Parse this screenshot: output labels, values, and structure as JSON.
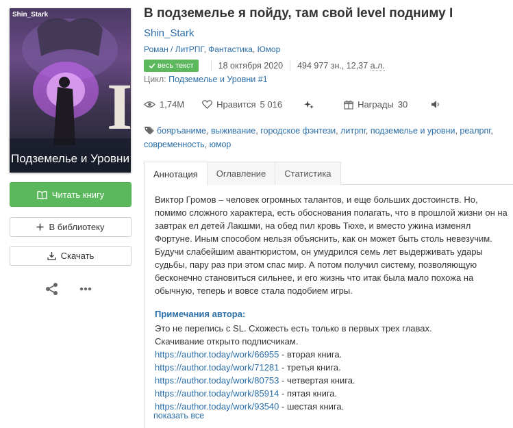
{
  "book": {
    "title": "В подземелье я пойду, там свой level подниму I",
    "author": "Shin_Stark",
    "genre_main": "Роман / ЛитРПГ",
    "genre_2": "Фантастика",
    "genre_3": "Юмор",
    "badge": "весь текст",
    "date": "18 октября 2020",
    "size_chars": "494 977 зн., 12,37",
    "size_unit": "а.л.",
    "cycle_label": "Цикл:",
    "cycle_name": "Подземелье и Уровни",
    "cycle_num": "#1"
  },
  "cover": {
    "author": "Shin_Stark",
    "numeral": "I",
    "title": "Подземелье и Уровни"
  },
  "actions": {
    "read": "Читать книгу",
    "library": "В библиотеку",
    "download": "Скачать"
  },
  "stats": {
    "views": "1,74M",
    "likes_label": "Нравится",
    "likes": "5 016",
    "awards_label": "Награды",
    "awards": "30"
  },
  "tags": [
    "бояръаниме",
    "выживание",
    "городское фэнтези",
    "литрпг",
    "подземелье и уровни",
    "реалрпг",
    "современность",
    "юмор"
  ],
  "tabs": [
    "Аннотация",
    "Оглавление",
    "Статистика"
  ],
  "annotation": [
    "Виктор Громов – человек огромных талантов, и еще больших достоинств. Но, помимо сложного характера, есть обоснования полагать, что в прошлой жизни он на завтрак ел детей Лакшми, на обед пил кровь Тюхе, и вместо ужина изменял Фортуне. Иным способом нельзя объяснить, как он может быть столь невезучим.",
    "Будучи слабейшим авантюристом, он умудрился семь лет выдерживать удары судьбы, пару раз при этом спас мир. А потом получил систему, позволяющую бесконечно ста­новиться сильнее, и его жизнь что итак была мало похожа на обычную, теперь и во­все стала подобием игры."
  ],
  "notes": {
    "heading": "Примечания автора:",
    "line1": "Это не перепись с SL. Схожесть есть только в первых трех главах.",
    "line2": "Скачивание открыто подписчикам.",
    "links": [
      {
        "url": "https://author.today/work/66955",
        "text": " - вторая книга."
      },
      {
        "url": "https://author.today/work/71281",
        "text": " - третья книга."
      },
      {
        "url": "https://author.today/work/80753",
        "text": " - четвертая книга."
      },
      {
        "url": "https://author.today/work/85914",
        "text": " - пятая книга."
      },
      {
        "url": "https://author.today/work/93540",
        "text": " - шестая книга."
      }
    ],
    "show_all": "показать все"
  },
  "colors": {
    "green": "#5cb85c",
    "link": "#2c6ea8"
  }
}
